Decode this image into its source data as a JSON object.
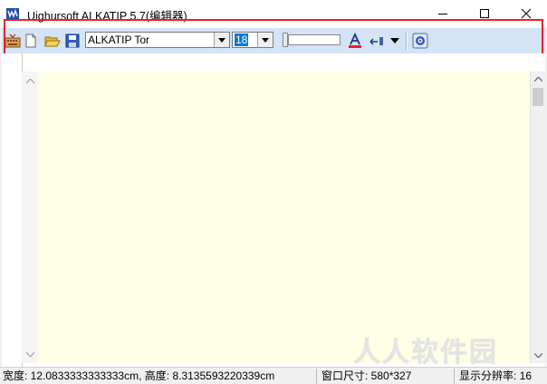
{
  "window": {
    "title": "Uighursoft ALKATIP 5.7(编辑器)"
  },
  "toolbar": {
    "font_name": "ALKATIP Tor",
    "font_size": "18"
  },
  "status": {
    "size_text": "宽度: 12.0833333333333cm, 高度: 8.3135593220339cm",
    "window_size": "窗口尺寸: 580*327",
    "resolution": "显示分辨率: 16"
  },
  "watermark": "人人软件园",
  "colors": {
    "toolbar_bg": "#d4e3f5",
    "editor_bg": "#ffffe6",
    "highlight_border": "#e8212b",
    "text_color_swatch": "#e8212b"
  },
  "icons": {
    "app": "alkatip-app-icon",
    "keyboard": "keyboard-icon",
    "new": "new-document-icon",
    "open": "open-folder-icon",
    "save": "save-icon",
    "text_color": "text-color-icon",
    "direction": "text-direction-icon",
    "dropdown": "chevron-down-icon",
    "help": "help-globe-icon"
  }
}
